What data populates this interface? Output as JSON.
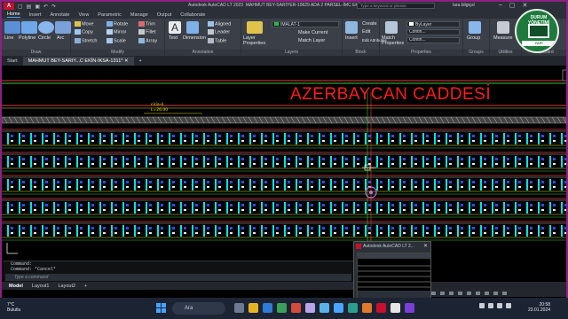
{
  "titlebar": {
    "app_title": "Autodesk AutoCAD LT 2023",
    "file_title": "MAHMUT BEY-SARIYER-10629 ADA 2 PARSEL-İMC EKİN-İKSA-1311.dwg",
    "search_placeholder": "Type a keyword or phrase",
    "user": "lara.bilgiçsl"
  },
  "menu_tabs": [
    "Home",
    "Insert",
    "Annotate",
    "View",
    "Parametric",
    "Manage",
    "Output",
    "Collaborate"
  ],
  "ribbon": {
    "draw": {
      "label": "Draw",
      "tools": [
        "Line",
        "Polyline",
        "Circle",
        "Arc"
      ]
    },
    "modify": {
      "label": "Modify",
      "tools": [
        "Move",
        "Rotate",
        "Trim",
        "Copy",
        "Mirror",
        "Fillet",
        "Stretch",
        "Scale",
        "Array"
      ]
    },
    "annotation": {
      "label": "Annotation",
      "tools": [
        "Text",
        "Dimension",
        "Aligned",
        "Leader",
        "Table"
      ]
    },
    "layers": {
      "label": "Layers",
      "tools": [
        "Layer Properties",
        "Make Current",
        "Match Layer"
      ],
      "current_layer": "İMALAT-1"
    },
    "block": {
      "label": "Block",
      "tools": [
        "Insert",
        "Create",
        "Edit",
        "Edit Attributes"
      ]
    },
    "properties": {
      "label": "Properties",
      "tools": [
        "Match Properties"
      ],
      "color": "ByLayer",
      "linetype": "Contin...",
      "lineweight": "Contin..."
    },
    "groups": {
      "label": "Groups",
      "tools": [
        "Group"
      ]
    },
    "utilities": {
      "label": "Utilities",
      "tools": [
        "Measure"
      ]
    },
    "clipboard": {
      "label": "Clipboard"
    }
  },
  "doc_tabs": [
    "Start",
    "MAHMUT BEY-SARIY...C EKİN-İKSA-1311*"
  ],
  "canvas": {
    "street_title": "AZERBAYCAN CADDESİ",
    "annotation_small": "ciria-4",
    "annotation_value": "L=26.00"
  },
  "command": {
    "lines": [
      "Command:",
      "Command: *Cancel*"
    ],
    "input_placeholder": "Type a command"
  },
  "layout_tabs": [
    "Model",
    "Layout1",
    "Layout2"
  ],
  "popup": {
    "title": "Autodesk AutoCAD LT 2..."
  },
  "badge": {
    "top_text": "DURUM YÖNETİMİ"
  },
  "taskbar": {
    "weather_temp": "7°C",
    "weather_desc": "Bulutlu",
    "search_label": "Ara",
    "time": "20:58",
    "date": "23.01.2024"
  },
  "colors": {
    "accent": "#4aa3ff",
    "frame": "#8e1f84",
    "title_red": "#ff1a1a",
    "cyan": "#00e5e5",
    "yellow": "#e8e000",
    "pink_marker": "#d26bd6"
  }
}
